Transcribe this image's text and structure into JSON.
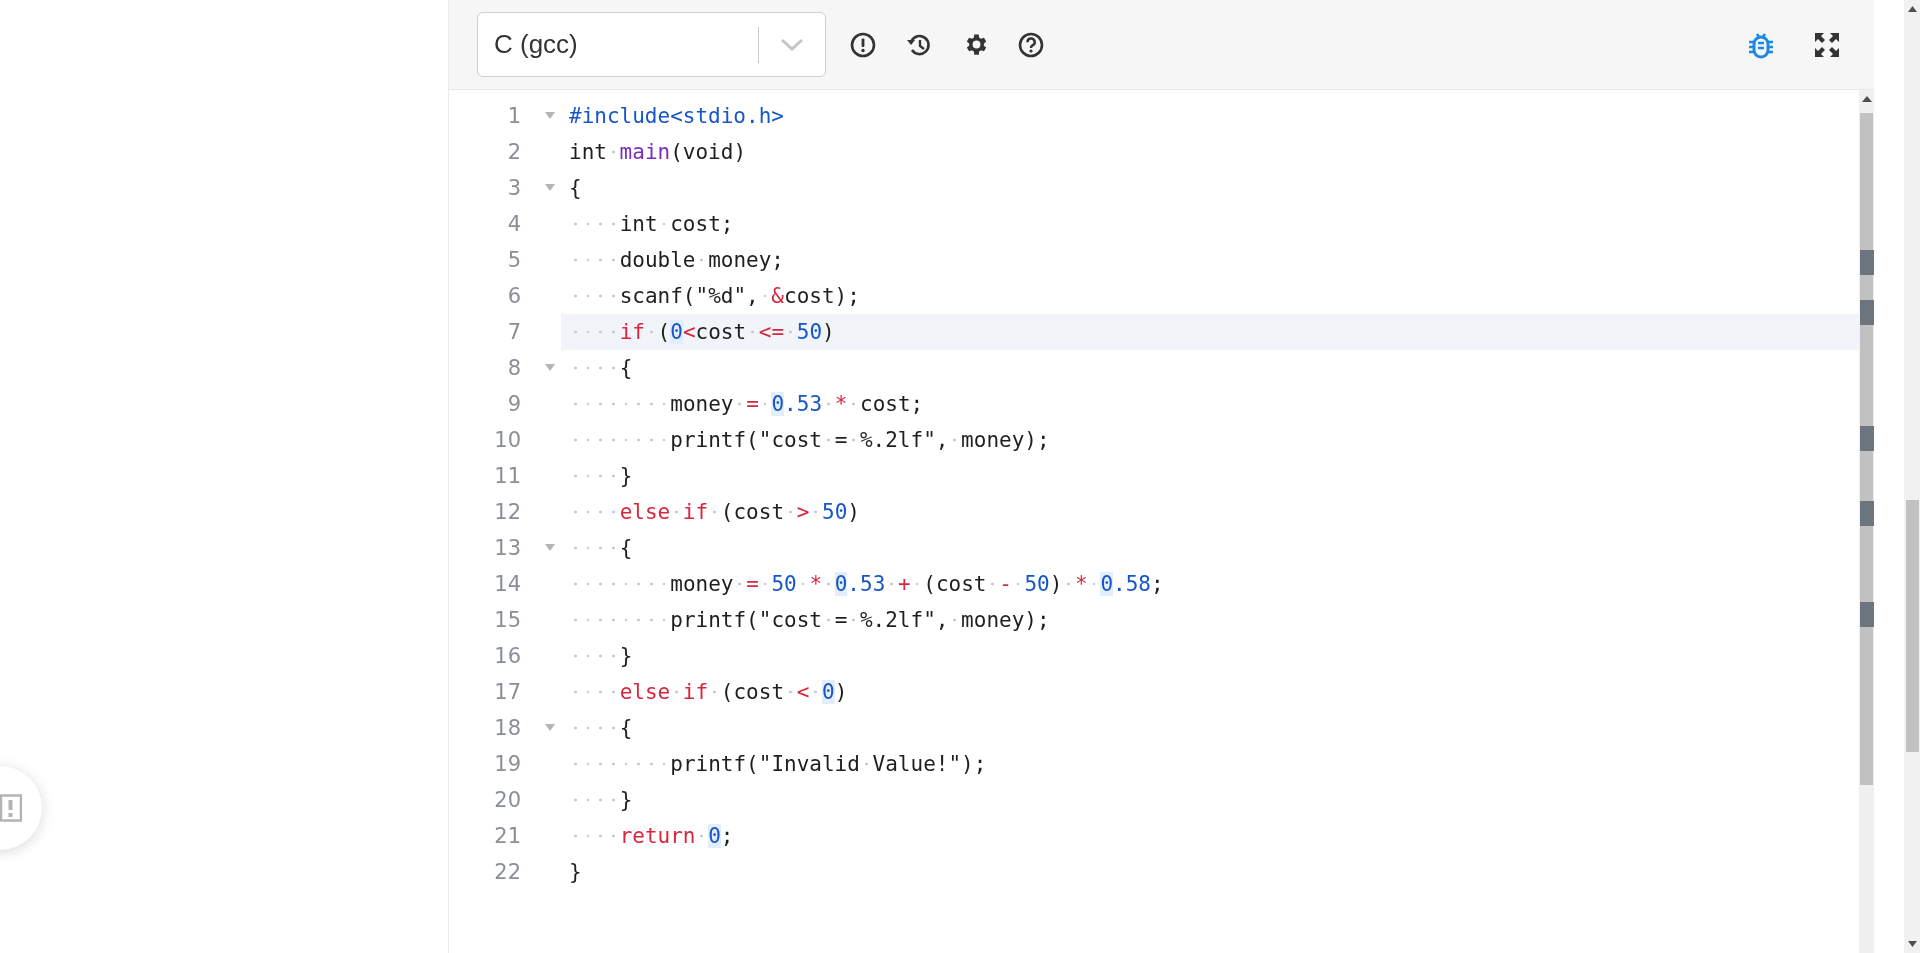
{
  "toolbar": {
    "language": "C (gcc)"
  },
  "editor": {
    "lines": [
      {
        "number": "1",
        "foldable": true,
        "active": false,
        "tokens": [
          {
            "text": "#include<stdio.h>",
            "kind": "preproc"
          }
        ]
      },
      {
        "number": "2",
        "foldable": false,
        "active": false,
        "tokens": [
          {
            "text": "int ",
            "kind": "plain"
          },
          {
            "text": "main",
            "kind": "function"
          },
          {
            "text": "(void)",
            "kind": "plain"
          }
        ]
      },
      {
        "number": "3",
        "foldable": true,
        "active": false,
        "tokens": [
          {
            "text": "{",
            "kind": "plain"
          }
        ]
      },
      {
        "number": "4",
        "foldable": false,
        "active": false,
        "tokens": [
          {
            "text": "    int cost;",
            "kind": "plain"
          }
        ]
      },
      {
        "number": "5",
        "foldable": false,
        "active": false,
        "tokens": [
          {
            "text": "    double money;",
            "kind": "plain"
          }
        ]
      },
      {
        "number": "6",
        "foldable": false,
        "active": false,
        "tokens": [
          {
            "text": "    scanf(\"%d\", ",
            "kind": "plain"
          },
          {
            "text": "&",
            "kind": "operator"
          },
          {
            "text": "cost);",
            "kind": "plain"
          }
        ]
      },
      {
        "number": "7",
        "foldable": false,
        "active": true,
        "tokens": [
          {
            "text": "    if",
            "kind": "keyword"
          },
          {
            "text": " (",
            "kind": "plain"
          },
          {
            "text": "0",
            "kind": "number",
            "highlighted": true
          },
          {
            "text": "<",
            "kind": "operator"
          },
          {
            "text": "cost ",
            "kind": "plain"
          },
          {
            "text": "<= ",
            "kind": "operator"
          },
          {
            "text": "50",
            "kind": "number"
          },
          {
            "text": ")",
            "kind": "plain"
          }
        ]
      },
      {
        "number": "8",
        "foldable": true,
        "active": false,
        "tokens": [
          {
            "text": "    {",
            "kind": "plain"
          }
        ]
      },
      {
        "number": "9",
        "foldable": false,
        "active": false,
        "tokens": [
          {
            "text": "        money ",
            "kind": "plain"
          },
          {
            "text": "= ",
            "kind": "operator"
          },
          {
            "text": "0",
            "kind": "number",
            "highlighted": true
          },
          {
            "text": ".53 ",
            "kind": "number"
          },
          {
            "text": "*",
            "kind": "operator"
          },
          {
            "text": " cost;",
            "kind": "plain"
          }
        ]
      },
      {
        "number": "10",
        "foldable": false,
        "active": false,
        "tokens": [
          {
            "text": "        printf(\"cost = %.2lf\", money);",
            "kind": "plain"
          }
        ]
      },
      {
        "number": "11",
        "foldable": false,
        "active": false,
        "tokens": [
          {
            "text": "    }",
            "kind": "plain"
          }
        ]
      },
      {
        "number": "12",
        "foldable": false,
        "active": false,
        "tokens": [
          {
            "text": "    else if",
            "kind": "keyword"
          },
          {
            "text": " (cost ",
            "kind": "plain"
          },
          {
            "text": "> ",
            "kind": "operator"
          },
          {
            "text": "50",
            "kind": "number"
          },
          {
            "text": ")",
            "kind": "plain"
          }
        ]
      },
      {
        "number": "13",
        "foldable": true,
        "active": false,
        "tokens": [
          {
            "text": "    {",
            "kind": "plain"
          }
        ]
      },
      {
        "number": "14",
        "foldable": false,
        "active": false,
        "tokens": [
          {
            "text": "        money ",
            "kind": "plain"
          },
          {
            "text": "= ",
            "kind": "operator"
          },
          {
            "text": "50 ",
            "kind": "number"
          },
          {
            "text": "* ",
            "kind": "operator"
          },
          {
            "text": "0",
            "kind": "number",
            "highlighted": true
          },
          {
            "text": ".53 ",
            "kind": "number"
          },
          {
            "text": "+",
            "kind": "operator"
          },
          {
            "text": " (cost ",
            "kind": "plain"
          },
          {
            "text": "- ",
            "kind": "operator"
          },
          {
            "text": "50",
            "kind": "number"
          },
          {
            "text": ") ",
            "kind": "plain"
          },
          {
            "text": "* ",
            "kind": "operator"
          },
          {
            "text": "0",
            "kind": "number",
            "highlighted": true
          },
          {
            "text": ".58",
            "kind": "number"
          },
          {
            "text": ";",
            "kind": "plain"
          }
        ]
      },
      {
        "number": "15",
        "foldable": false,
        "active": false,
        "tokens": [
          {
            "text": "        printf(\"cost = %.2lf\", money);",
            "kind": "plain"
          }
        ]
      },
      {
        "number": "16",
        "foldable": false,
        "active": false,
        "tokens": [
          {
            "text": "    }",
            "kind": "plain"
          }
        ]
      },
      {
        "number": "17",
        "foldable": false,
        "active": false,
        "tokens": [
          {
            "text": "    else if",
            "kind": "keyword"
          },
          {
            "text": " (cost ",
            "kind": "plain"
          },
          {
            "text": "< ",
            "kind": "operator"
          },
          {
            "text": "0",
            "kind": "number",
            "highlighted": true
          },
          {
            "text": ")",
            "kind": "plain"
          }
        ]
      },
      {
        "number": "18",
        "foldable": true,
        "active": false,
        "tokens": [
          {
            "text": "    {",
            "kind": "plain"
          }
        ]
      },
      {
        "number": "19",
        "foldable": false,
        "active": false,
        "tokens": [
          {
            "text": "        printf(\"Invalid Value!\");",
            "kind": "plain"
          }
        ]
      },
      {
        "number": "20",
        "foldable": false,
        "active": false,
        "tokens": [
          {
            "text": "    }",
            "kind": "plain"
          }
        ]
      },
      {
        "number": "21",
        "foldable": false,
        "active": false,
        "tokens": [
          {
            "text": "    return ",
            "kind": "keyword"
          },
          {
            "text": "0",
            "kind": "number",
            "highlighted": true
          },
          {
            "text": ";",
            "kind": "plain"
          }
        ]
      },
      {
        "number": "22",
        "foldable": false,
        "active": false,
        "tokens": [
          {
            "text": "}",
            "kind": "plain"
          }
        ]
      }
    ]
  }
}
